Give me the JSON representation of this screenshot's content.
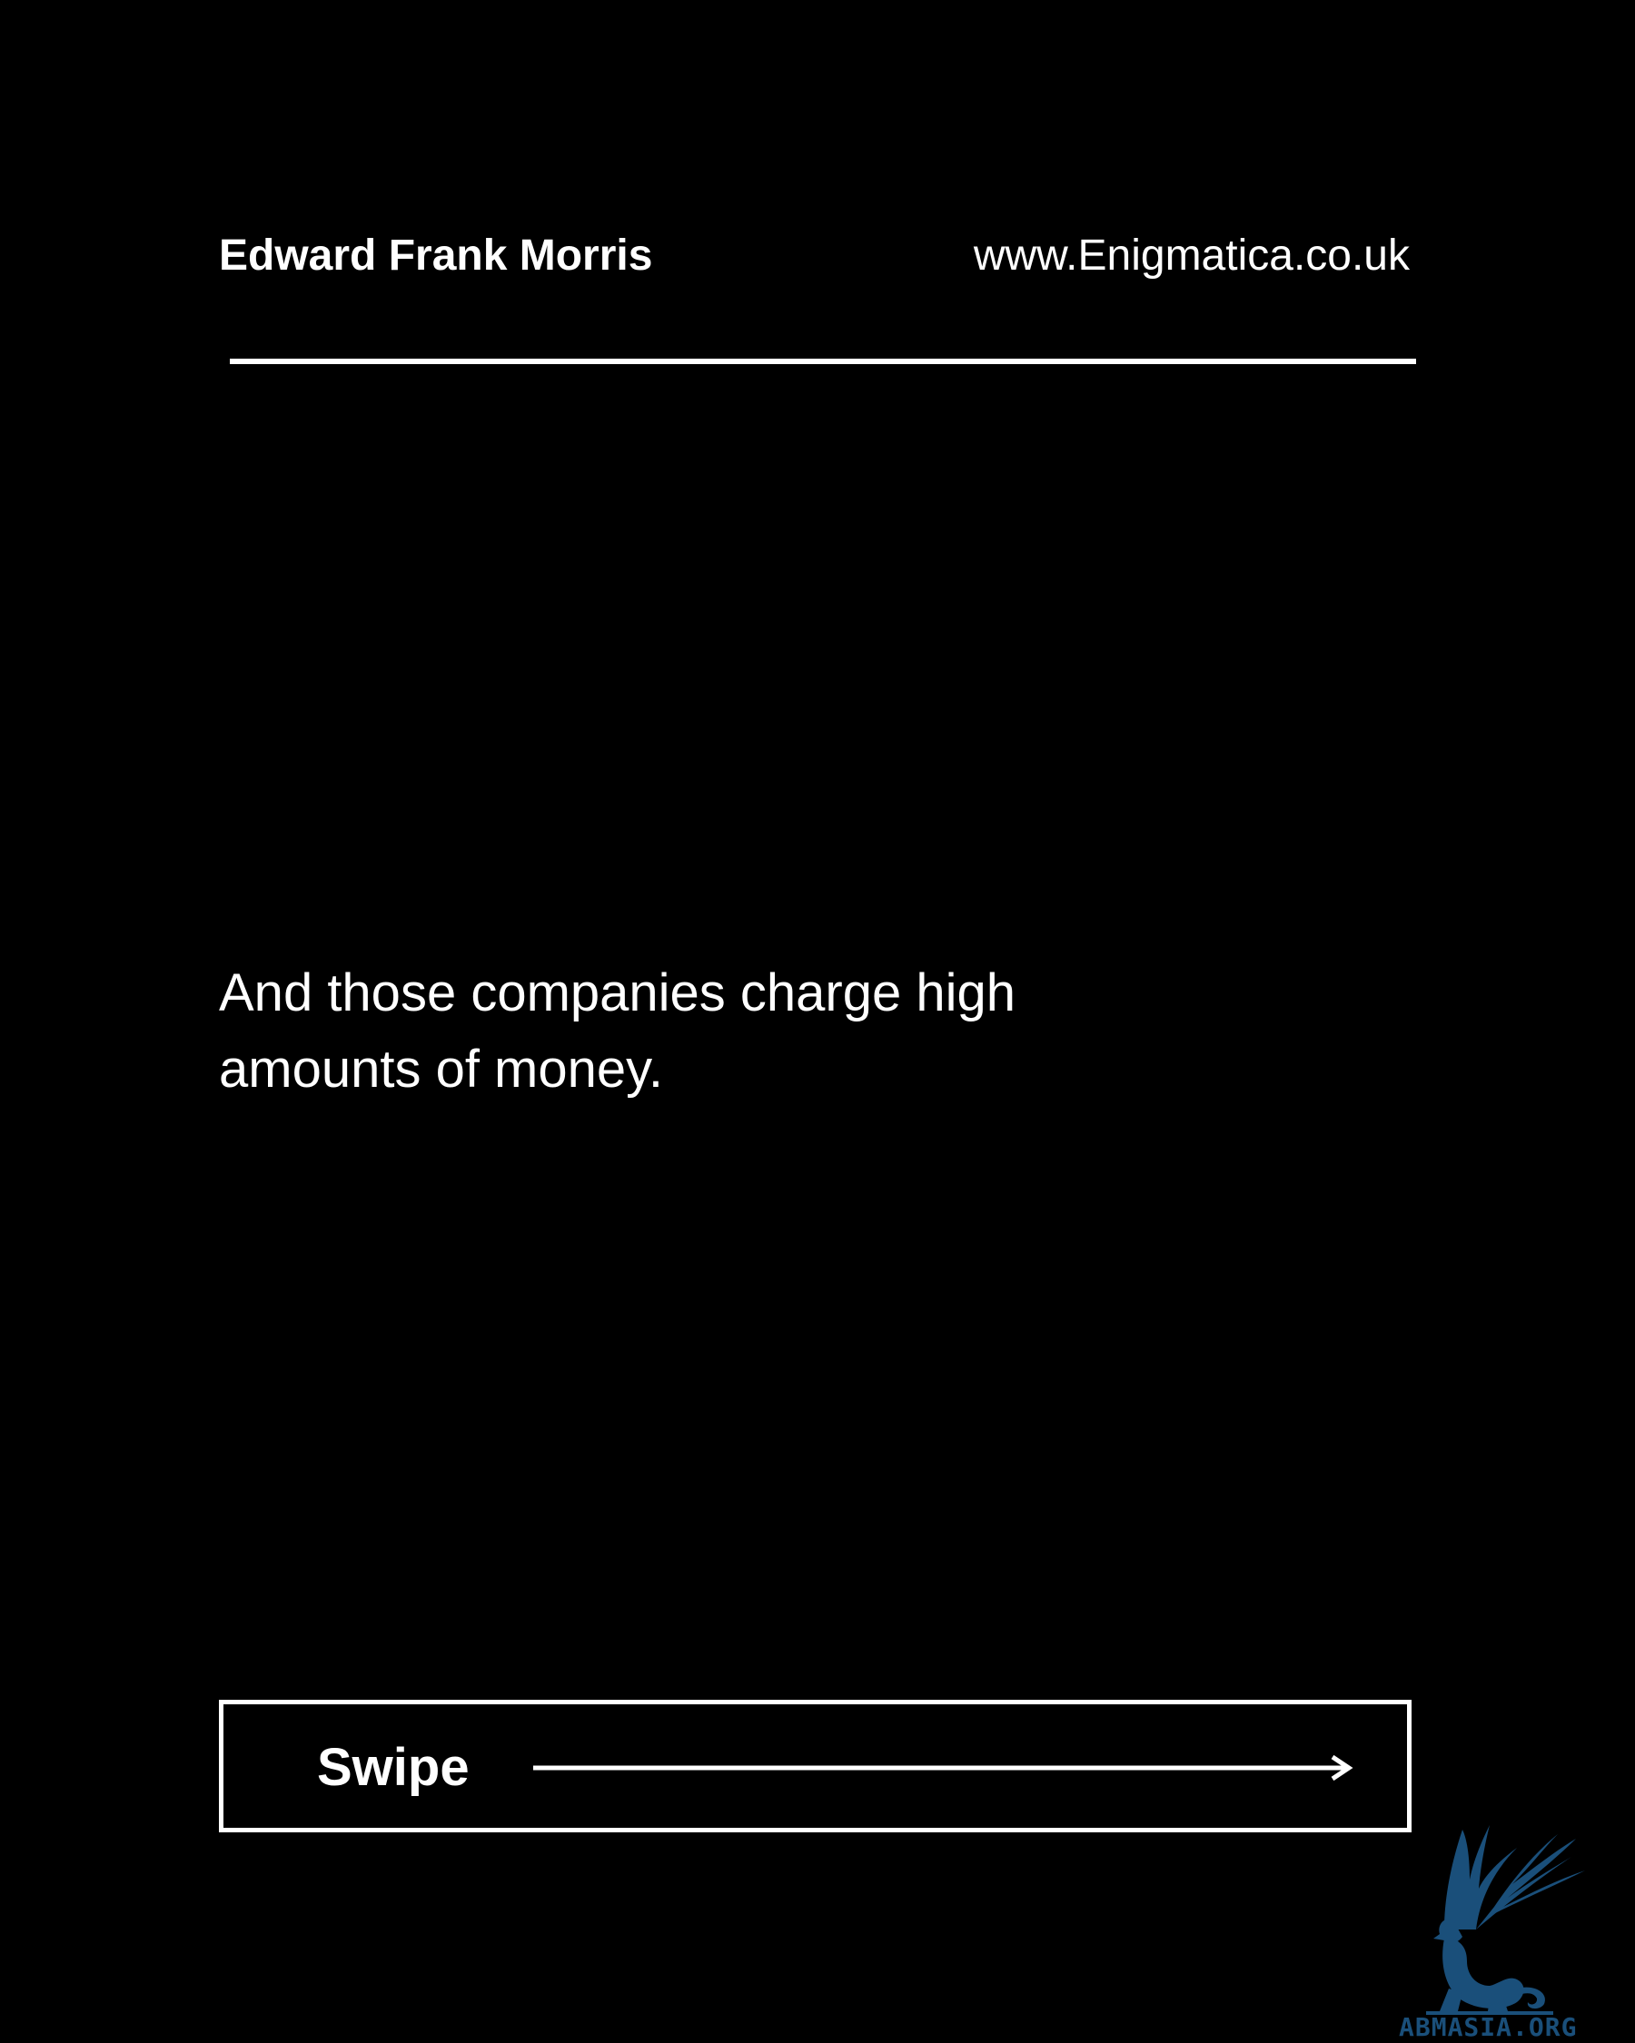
{
  "header": {
    "author": "Edward Frank Morris",
    "website": "www.Enigmatica.co.uk"
  },
  "main": {
    "text": "And those companies charge high amounts of money."
  },
  "footer": {
    "swipe_label": "Swipe"
  },
  "watermark": {
    "icon": "griffin-logo-icon",
    "text": "ABMASIA.ORG",
    "color": "#1a4f7a"
  },
  "colors": {
    "background": "#000000",
    "foreground": "#ffffff"
  }
}
